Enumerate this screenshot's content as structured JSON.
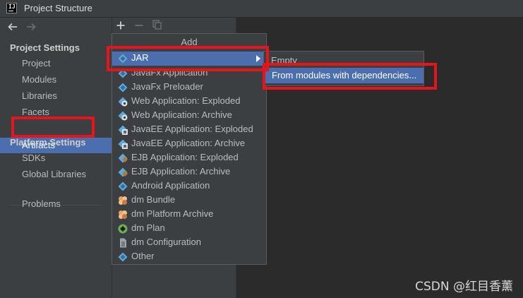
{
  "window": {
    "title": "Project Structure",
    "app_icon_label": "IJ"
  },
  "nav": {
    "back_icon": "arrow-left-icon",
    "forward_icon": "arrow-right-icon"
  },
  "sidebar": {
    "project_settings_header": "Project Settings",
    "project_settings_items": [
      "Project",
      "Modules",
      "Libraries",
      "Facets",
      "Artifacts"
    ],
    "selected_item": "Artifacts",
    "platform_settings_header": "Platform Settings",
    "platform_settings_items": [
      "SDKs",
      "Global Libraries"
    ],
    "other_items": [
      "Problems"
    ]
  },
  "toolbar": {
    "add_icon": "plus-icon",
    "remove_icon": "minus-icon",
    "copy_icon": "copy-icon"
  },
  "add_menu": {
    "header": "Add",
    "items": [
      {
        "label": "JAR",
        "icon": "jar-icon",
        "selected": true,
        "has_submenu": true
      },
      {
        "label": "JavaFx Application",
        "icon": "diamond-icon"
      },
      {
        "label": "JavaFx Preloader",
        "icon": "diamond-icon"
      },
      {
        "label": "Web Application: Exploded",
        "icon": "web-app-icon"
      },
      {
        "label": "Web Application: Archive",
        "icon": "web-app-icon"
      },
      {
        "label": "JavaEE Application: Exploded",
        "icon": "javaee-icon"
      },
      {
        "label": "JavaEE Application: Archive",
        "icon": "javaee-icon"
      },
      {
        "label": "EJB Application: Exploded",
        "icon": "ejb-icon"
      },
      {
        "label": "EJB Application: Archive",
        "icon": "ejb-icon"
      },
      {
        "label": "Android Application",
        "icon": "diamond-icon"
      },
      {
        "label": "dm Bundle",
        "icon": "dm-bundle-icon"
      },
      {
        "label": "dm Platform Archive",
        "icon": "dm-bundle-icon"
      },
      {
        "label": "dm Plan",
        "icon": "dm-plan-icon"
      },
      {
        "label": "dm Configuration",
        "icon": "document-icon"
      },
      {
        "label": "Other",
        "icon": "diamond-icon"
      }
    ]
  },
  "jar_submenu": {
    "items": [
      {
        "label": "Empty"
      },
      {
        "label": "From modules with dependencies...",
        "selected": true
      }
    ]
  },
  "watermark": "CSDN @红目香薰",
  "colors": {
    "selection": "#4b6eaf",
    "highlight_box": "#e8141c",
    "panel": "#3c3f41",
    "background": "#2b2b2b"
  }
}
